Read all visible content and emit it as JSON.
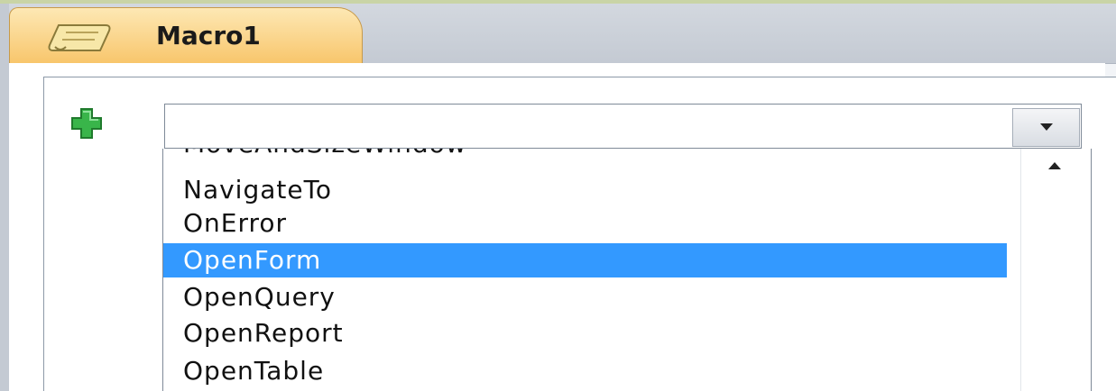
{
  "tab": {
    "title": "Macro1",
    "icon": "macro-scroll-icon"
  },
  "add_action": {
    "icon": "green-plus-icon"
  },
  "action_combo": {
    "value": "",
    "dropdown_icon": "chevron-down-icon"
  },
  "action_list": {
    "items": [
      {
        "label": "MoveAndSizeWindow",
        "selected": false
      },
      {
        "label": "NavigateTo",
        "selected": false
      },
      {
        "label": "OnError",
        "selected": false
      },
      {
        "label": "OpenForm",
        "selected": true
      },
      {
        "label": "OpenQuery",
        "selected": false
      },
      {
        "label": "OpenReport",
        "selected": false
      },
      {
        "label": "OpenTable",
        "selected": false
      }
    ],
    "scroll_up_icon": "chevron-up-icon"
  },
  "colors": {
    "tab_active": "#f8c66c",
    "selection": "#3399ff",
    "plus_icon": "#39b54a"
  }
}
